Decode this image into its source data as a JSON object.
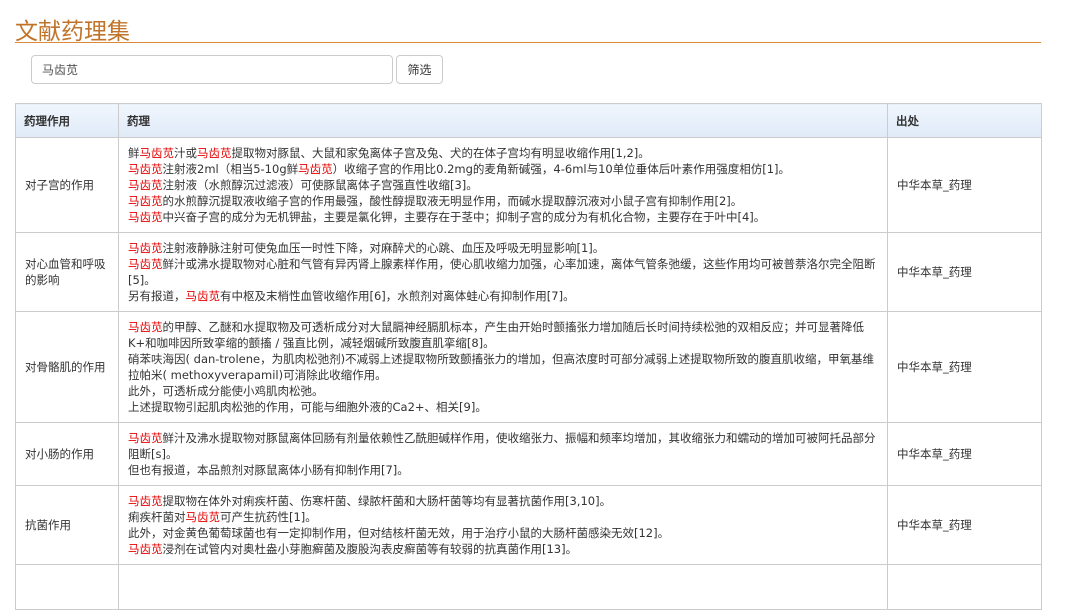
{
  "page_title": "文献药理集",
  "search": {
    "value": "马齿苋",
    "button": "筛选"
  },
  "table": {
    "headers": [
      "药理作用",
      "药理",
      "出处"
    ],
    "rows": [
      {
        "effect": "对子宫的作用",
        "source": "中华本草_药理",
        "lines": [
          [
            {
              "t": "鲜"
            },
            {
              "t": "马齿苋",
              "hl": true
            },
            {
              "t": "汁或"
            },
            {
              "t": "马齿苋",
              "hl": true
            },
            {
              "t": "提取物对豚鼠、大鼠和家兔离体子宫及兔、犬的在体子宫均有明显收缩作用[1,2]。"
            }
          ],
          [
            {
              "t": "马齿苋",
              "hl": true
            },
            {
              "t": "注射液2ml（相当5-10g鲜"
            },
            {
              "t": "马齿苋",
              "hl": true
            },
            {
              "t": "）收缩子宫的作用比0.2mg的麦角新碱强，4-6ml与10单位垂体后叶素作用强度相仿[1]。"
            }
          ],
          [
            {
              "t": "马齿苋",
              "hl": true
            },
            {
              "t": "注射液（水煎醇沉过滤液）可使豚鼠离体子宫强直性收缩[3]。"
            }
          ],
          [
            {
              "t": "马齿苋",
              "hl": true
            },
            {
              "t": "的水煎醇沉提取液收缩子宫的作用最强，酸性醇提取液无明显作用，而碱水提取醇沉液对小鼠子宫有抑制作用[2]。"
            }
          ],
          [
            {
              "t": "马齿苋",
              "hl": true
            },
            {
              "t": "中兴奋子宫的成分为无机钾盐，主要是氯化钾，主要存在于茎中；抑制子宫的成分为有机化合物，主要存在于叶中[4]。"
            }
          ]
        ]
      },
      {
        "effect": "对心血管和呼吸的影响",
        "source": "中华本草_药理",
        "lines": [
          [
            {
              "t": "马齿苋",
              "hl": true
            },
            {
              "t": "注射液静脉注射可使兔血压一时性下降，对麻醉犬的心跳、血压及呼吸无明显影响[1]。"
            }
          ],
          [
            {
              "t": "马齿苋",
              "hl": true
            },
            {
              "t": "鲜汁或沸水提取物对心脏和气管有异丙肾上腺素样作用，使心肌收缩力加强，心率加速，离体气管条弛缓，这些作用均可被普萘洛尔完全阻断[5]。"
            }
          ],
          [
            {
              "t": "另有报道，"
            },
            {
              "t": "马齿苋",
              "hl": true
            },
            {
              "t": "有中枢及末梢性血管收缩作用[6]，水煎剂对离体蛙心有抑制作用[7]。"
            }
          ]
        ]
      },
      {
        "effect": "对骨骼肌的作用",
        "source": "中华本草_药理",
        "lines": [
          [
            {
              "t": "马齿苋",
              "hl": true
            },
            {
              "t": "的甲醇、乙醚和水提取物及可透析成分对大鼠膈神经膈肌标本，产生由开始时颤搐张力增加随后长时间持续松弛的双相反应；并可显著降低K+和咖啡因所致挛缩的颤搐 / 强直比例，减轻烟碱所致腹直肌挛缩[8]。"
            }
          ],
          [
            {
              "t": "硝苯呋海因( dan-trolene，为肌肉松弛剂)不减弱上述提取物所致颤搐张力的增加，但高浓度时可部分减弱上述提取物所致的腹直肌收缩，甲氧基维拉帕米( methoxyverapamil)可消除此收缩作用。"
            }
          ],
          [
            {
              "t": "此外，可透析成分能使小鸡肌肉松弛。"
            }
          ],
          [
            {
              "t": "上述提取物引起肌肉松弛的作用，可能与细胞外液的Ca2+、相关[9]。"
            }
          ]
        ]
      },
      {
        "effect": "对小肠的作用",
        "source": "中华本草_药理",
        "lines": [
          [
            {
              "t": "马齿苋",
              "hl": true
            },
            {
              "t": "鲜汁及沸水提取物对豚鼠离体回肠有剂量依赖性乙酰胆碱样作用，使收缩张力、振幅和频率均增加，其收缩张力和蠕动的增加可被阿托品部分阻断[s]。"
            }
          ],
          [
            {
              "t": "但也有报道，本品煎剂对豚鼠离体小肠有抑制作用[7]。"
            }
          ]
        ]
      },
      {
        "effect": "抗菌作用",
        "source": "中华本草_药理",
        "lines": [
          [
            {
              "t": "马齿苋",
              "hl": true
            },
            {
              "t": "提取物在体外对痢疾杆菌、伤寒杆菌、绿脓杆菌和大肠杆菌等均有显著抗菌作用[3,10]。"
            }
          ],
          [
            {
              "t": "痢疾杆菌对"
            },
            {
              "t": "马齿苋",
              "hl": true
            },
            {
              "t": "可产生抗药性[1]。"
            }
          ],
          [
            {
              "t": "此外，对金黄色葡萄球菌也有一定抑制作用，但对结核杆菌无效，用于治疗小鼠的大肠杆菌感染无效[12]。"
            }
          ],
          [
            {
              "t": "马齿苋",
              "hl": true
            },
            {
              "t": "浸剂在试管内对奥杜盎小芽胞癣菌及腹股沟表皮癣菌等有较弱的抗真菌作用[13]。"
            }
          ]
        ]
      }
    ]
  },
  "colors": {
    "title": "#c0742a",
    "highlight": "#e60000",
    "header_bg": "#e4eefa"
  }
}
